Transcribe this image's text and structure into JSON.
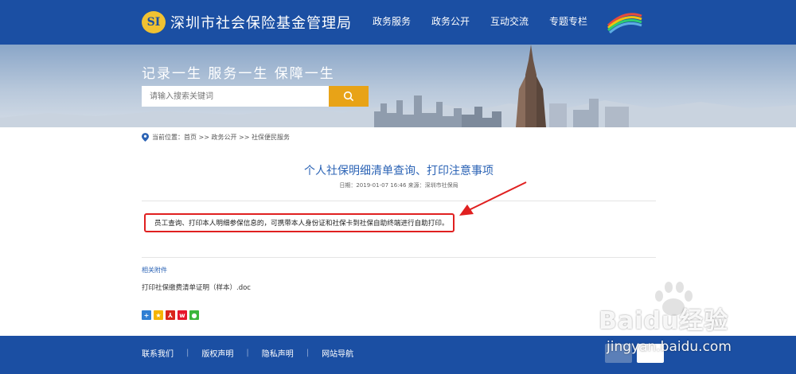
{
  "header": {
    "logo_mark": "SI",
    "title": "深圳市社会保险基金管理局",
    "nav": [
      "政务服务",
      "政务公开",
      "互动交流",
      "专题专栏"
    ]
  },
  "hero": {
    "slogan": "记录一生   服务一生   保障一生",
    "search_placeholder": "请输入搜索关键词"
  },
  "breadcrumb": {
    "text": "当前位置：首页 >> 政务公开 >> 社保便民服务"
  },
  "article": {
    "title": "个人社保明细清单查询、打印注意事项",
    "meta": "日期：2019-01-07 16:46 来源：深圳市社保局",
    "body": "员工查询、打印本人明细参保信息的，可携带本人身份证和社保卡到社保自助终端进行自助打印。"
  },
  "attachments": {
    "label": "相关附件",
    "file": "打印社保缴费清单证明（样本）.doc"
  },
  "share_icons": [
    "add-share-icon",
    "qzone-icon",
    "pdf-share-icon",
    "weibo-icon",
    "wechat-icon"
  ],
  "footer": {
    "links": [
      "联系我们",
      "版权声明",
      "隐私声明",
      "网站导航"
    ]
  },
  "watermark": {
    "text": "Baidu经验",
    "url": "jingyan.baidu.com"
  },
  "colors": {
    "brand_blue": "#1b4fa3",
    "title_blue": "#2b63b5",
    "search_button": "#e8a317",
    "highlight_red": "#e02020"
  }
}
